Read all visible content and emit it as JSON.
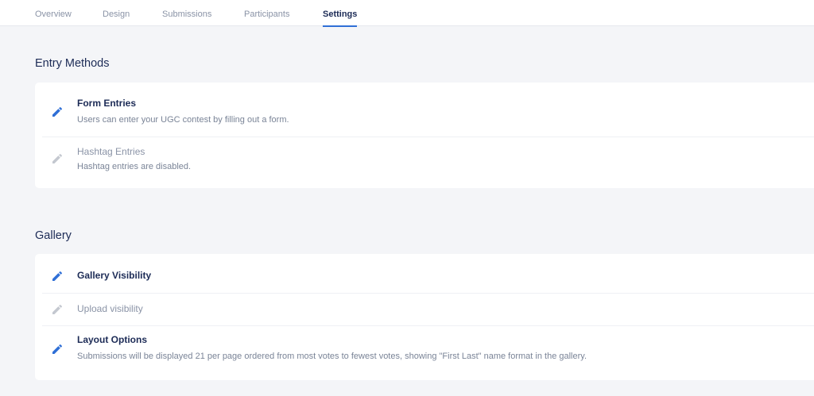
{
  "tabs": [
    {
      "label": "Overview",
      "active": false
    },
    {
      "label": "Design",
      "active": false
    },
    {
      "label": "Submissions",
      "active": false
    },
    {
      "label": "Participants",
      "active": false
    },
    {
      "label": "Settings",
      "active": true
    }
  ],
  "entry_methods": {
    "title": "Entry Methods",
    "items": [
      {
        "title": "Form Entries",
        "description": "Users can enter your UGC contest by filling out a form.",
        "enabled": true,
        "icon": "pencil-icon"
      },
      {
        "title": "Hashtag Entries",
        "description": "Hashtag entries are disabled.",
        "enabled": false,
        "icon": "pencil-icon"
      }
    ]
  },
  "gallery": {
    "title": "Gallery",
    "items": [
      {
        "title": "Gallery Visibility",
        "description": "",
        "enabled": true,
        "icon": "pencil-icon"
      },
      {
        "title": "Upload visibility",
        "description": "",
        "enabled": false,
        "icon": "pencil-icon"
      },
      {
        "title": "Layout Options",
        "description": "Submissions will be displayed 21 per page ordered from most votes to fewest votes, showing \"First Last\" name format in the gallery.",
        "enabled": true,
        "icon": "pencil-icon"
      }
    ]
  },
  "colors": {
    "accent": "#2f6fd6",
    "heading": "#1c2b56",
    "muted": "#8a93a6",
    "icon_disabled": "#c4c8d0",
    "background": "#f4f5f8"
  }
}
